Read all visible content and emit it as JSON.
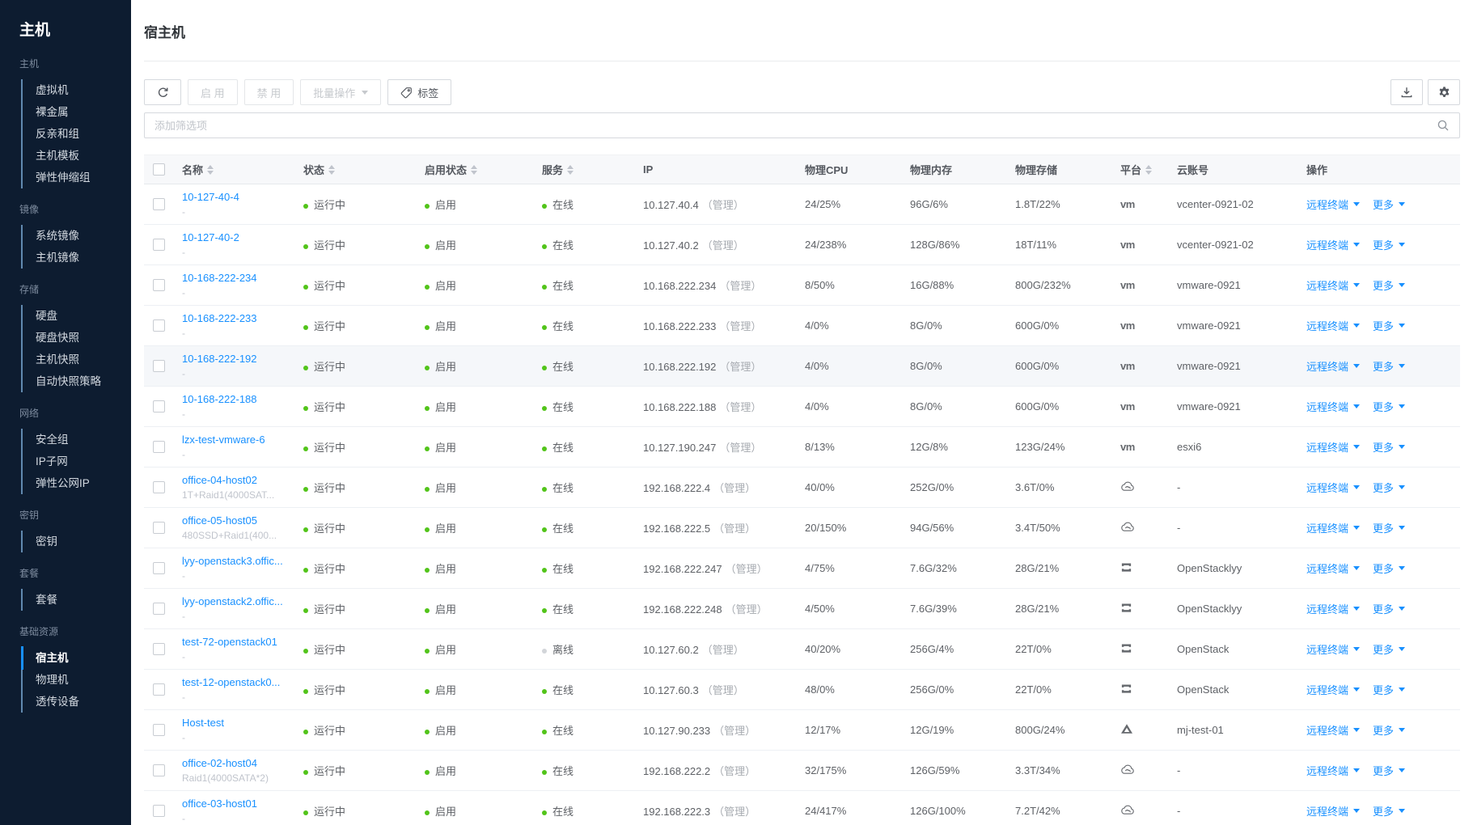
{
  "sidebar": {
    "title": "主机",
    "groups": [
      {
        "label": "主机",
        "items": [
          {
            "label": "虚拟机"
          },
          {
            "label": "裸金属"
          },
          {
            "label": "反亲和组"
          },
          {
            "label": "主机模板"
          },
          {
            "label": "弹性伸缩组"
          }
        ]
      },
      {
        "label": "镜像",
        "items": [
          {
            "label": "系统镜像"
          },
          {
            "label": "主机镜像"
          }
        ]
      },
      {
        "label": "存储",
        "items": [
          {
            "label": "硬盘"
          },
          {
            "label": "硬盘快照"
          },
          {
            "label": "主机快照"
          },
          {
            "label": "自动快照策略"
          }
        ]
      },
      {
        "label": "网络",
        "items": [
          {
            "label": "安全组"
          },
          {
            "label": "IP子网"
          },
          {
            "label": "弹性公网IP"
          }
        ]
      },
      {
        "label": "密钥",
        "items": [
          {
            "label": "密钥"
          }
        ]
      },
      {
        "label": "套餐",
        "items": [
          {
            "label": "套餐"
          }
        ]
      },
      {
        "label": "基础资源",
        "items": [
          {
            "label": "宿主机",
            "active": true
          },
          {
            "label": "物理机"
          },
          {
            "label": "透传设备"
          }
        ]
      }
    ]
  },
  "page": {
    "title": "宿主机"
  },
  "toolbar": {
    "enable_label": "启 用",
    "disable_label": "禁 用",
    "batch_label": "批量操作",
    "tag_label": "标签"
  },
  "filter": {
    "placeholder": "添加筛选项"
  },
  "table": {
    "columns": [
      {
        "key": "name",
        "label": "名称",
        "sortable": true
      },
      {
        "key": "status",
        "label": "状态",
        "sortable": true
      },
      {
        "key": "enabled",
        "label": "启用状态",
        "sortable": true
      },
      {
        "key": "service",
        "label": "服务",
        "sortable": true
      },
      {
        "key": "ip",
        "label": "IP",
        "sortable": false
      },
      {
        "key": "cpu",
        "label": "物理CPU",
        "sortable": false
      },
      {
        "key": "mem",
        "label": "物理内存",
        "sortable": false
      },
      {
        "key": "storage",
        "label": "物理存储",
        "sortable": false
      },
      {
        "key": "platform",
        "label": "平台",
        "sortable": true
      },
      {
        "key": "account",
        "label": "云账号",
        "sortable": false
      },
      {
        "key": "actions",
        "label": "操作",
        "sortable": false
      }
    ],
    "ip_suffix": "（管理）",
    "action_terminal": "远程终端",
    "action_more": "更多",
    "rows": [
      {
        "name": "10-127-40-4",
        "sub": "-",
        "status": "运行中",
        "enabled": "启用",
        "service": "在线",
        "service_state": "online",
        "ip": "10.127.40.4",
        "cpu": "24/25%",
        "mem": "96G/6%",
        "storage": "1.8T/22%",
        "platform": "vmware",
        "account": "vcenter-0921-02"
      },
      {
        "name": "10-127-40-2",
        "sub": "-",
        "status": "运行中",
        "enabled": "启用",
        "service": "在线",
        "service_state": "online",
        "ip": "10.127.40.2",
        "cpu": "24/238%",
        "mem": "128G/86%",
        "storage": "18T/11%",
        "platform": "vmware",
        "account": "vcenter-0921-02"
      },
      {
        "name": "10-168-222-234",
        "sub": "-",
        "status": "运行中",
        "enabled": "启用",
        "service": "在线",
        "service_state": "online",
        "ip": "10.168.222.234",
        "cpu": "8/50%",
        "mem": "16G/88%",
        "storage": "800G/232%",
        "platform": "vmware",
        "account": "vmware-0921"
      },
      {
        "name": "10-168-222-233",
        "sub": "-",
        "status": "运行中",
        "enabled": "启用",
        "service": "在线",
        "service_state": "online",
        "ip": "10.168.222.233",
        "cpu": "4/0%",
        "mem": "8G/0%",
        "storage": "600G/0%",
        "platform": "vmware",
        "account": "vmware-0921"
      },
      {
        "name": "10-168-222-192",
        "sub": "-",
        "status": "运行中",
        "enabled": "启用",
        "service": "在线",
        "service_state": "online",
        "ip": "10.168.222.192",
        "cpu": "4/0%",
        "mem": "8G/0%",
        "storage": "600G/0%",
        "platform": "vmware",
        "account": "vmware-0921",
        "highlighted": true
      },
      {
        "name": "10-168-222-188",
        "sub": "-",
        "status": "运行中",
        "enabled": "启用",
        "service": "在线",
        "service_state": "online",
        "ip": "10.168.222.188",
        "cpu": "4/0%",
        "mem": "8G/0%",
        "storage": "600G/0%",
        "platform": "vmware",
        "account": "vmware-0921"
      },
      {
        "name": "lzx-test-vmware-6",
        "sub": "-",
        "status": "运行中",
        "enabled": "启用",
        "service": "在线",
        "service_state": "online",
        "ip": "10.127.190.247",
        "cpu": "8/13%",
        "mem": "12G/8%",
        "storage": "123G/24%",
        "platform": "vmware",
        "account": "esxi6"
      },
      {
        "name": "office-04-host02",
        "sub": "1T+Raid1(4000SAT...",
        "status": "运行中",
        "enabled": "启用",
        "service": "在线",
        "service_state": "online",
        "ip": "192.168.222.4",
        "cpu": "40/0%",
        "mem": "252G/0%",
        "storage": "3.6T/0%",
        "platform": "cloud",
        "account": "-"
      },
      {
        "name": "office-05-host05",
        "sub": "480SSD+Raid1(400...",
        "status": "运行中",
        "enabled": "启用",
        "service": "在线",
        "service_state": "online",
        "ip": "192.168.222.5",
        "cpu": "20/150%",
        "mem": "94G/56%",
        "storage": "3.4T/50%",
        "platform": "cloud",
        "account": "-"
      },
      {
        "name": "lyy-openstack3.offic...",
        "sub": "-",
        "status": "运行中",
        "enabled": "启用",
        "service": "在线",
        "service_state": "online",
        "ip": "192.168.222.247",
        "cpu": "4/75%",
        "mem": "7.6G/32%",
        "storage": "28G/21%",
        "platform": "openstack",
        "account": "OpenStacklyy"
      },
      {
        "name": "lyy-openstack2.offic...",
        "sub": "-",
        "status": "运行中",
        "enabled": "启用",
        "service": "在线",
        "service_state": "online",
        "ip": "192.168.222.248",
        "cpu": "4/50%",
        "mem": "7.6G/39%",
        "storage": "28G/21%",
        "platform": "openstack",
        "account": "OpenStacklyy"
      },
      {
        "name": "test-72-openstack01",
        "sub": "-",
        "status": "运行中",
        "enabled": "启用",
        "service": "离线",
        "service_state": "offline",
        "ip": "10.127.60.2",
        "cpu": "40/20%",
        "mem": "256G/4%",
        "storage": "22T/0%",
        "platform": "openstack",
        "account": "OpenStack"
      },
      {
        "name": "test-12-openstack0...",
        "sub": "-",
        "status": "运行中",
        "enabled": "启用",
        "service": "在线",
        "service_state": "online",
        "ip": "10.127.60.3",
        "cpu": "48/0%",
        "mem": "256G/0%",
        "storage": "22T/0%",
        "platform": "openstack",
        "account": "OpenStack"
      },
      {
        "name": "Host-test",
        "sub": "-",
        "status": "运行中",
        "enabled": "启用",
        "service": "在线",
        "service_state": "online",
        "ip": "10.127.90.233",
        "cpu": "12/17%",
        "mem": "12G/19%",
        "storage": "800G/24%",
        "platform": "mountain",
        "account": "mj-test-01"
      },
      {
        "name": "office-02-host04",
        "sub": "Raid1(4000SATA*2)",
        "status": "运行中",
        "enabled": "启用",
        "service": "在线",
        "service_state": "online",
        "ip": "192.168.222.2",
        "cpu": "32/175%",
        "mem": "126G/59%",
        "storage": "3.3T/34%",
        "platform": "cloud",
        "account": "-"
      },
      {
        "name": "office-03-host01",
        "sub": "-",
        "status": "运行中",
        "enabled": "启用",
        "service": "在线",
        "service_state": "online",
        "ip": "192.168.222.3",
        "cpu": "24/417%",
        "mem": "126G/100%",
        "storage": "7.2T/42%",
        "platform": "cloud",
        "account": "-"
      }
    ]
  },
  "colors": {
    "accent": "#1890ff",
    "online": "#52c41a",
    "offline": "#d2d5d9",
    "sidebar_bg": "#0d1c30"
  }
}
